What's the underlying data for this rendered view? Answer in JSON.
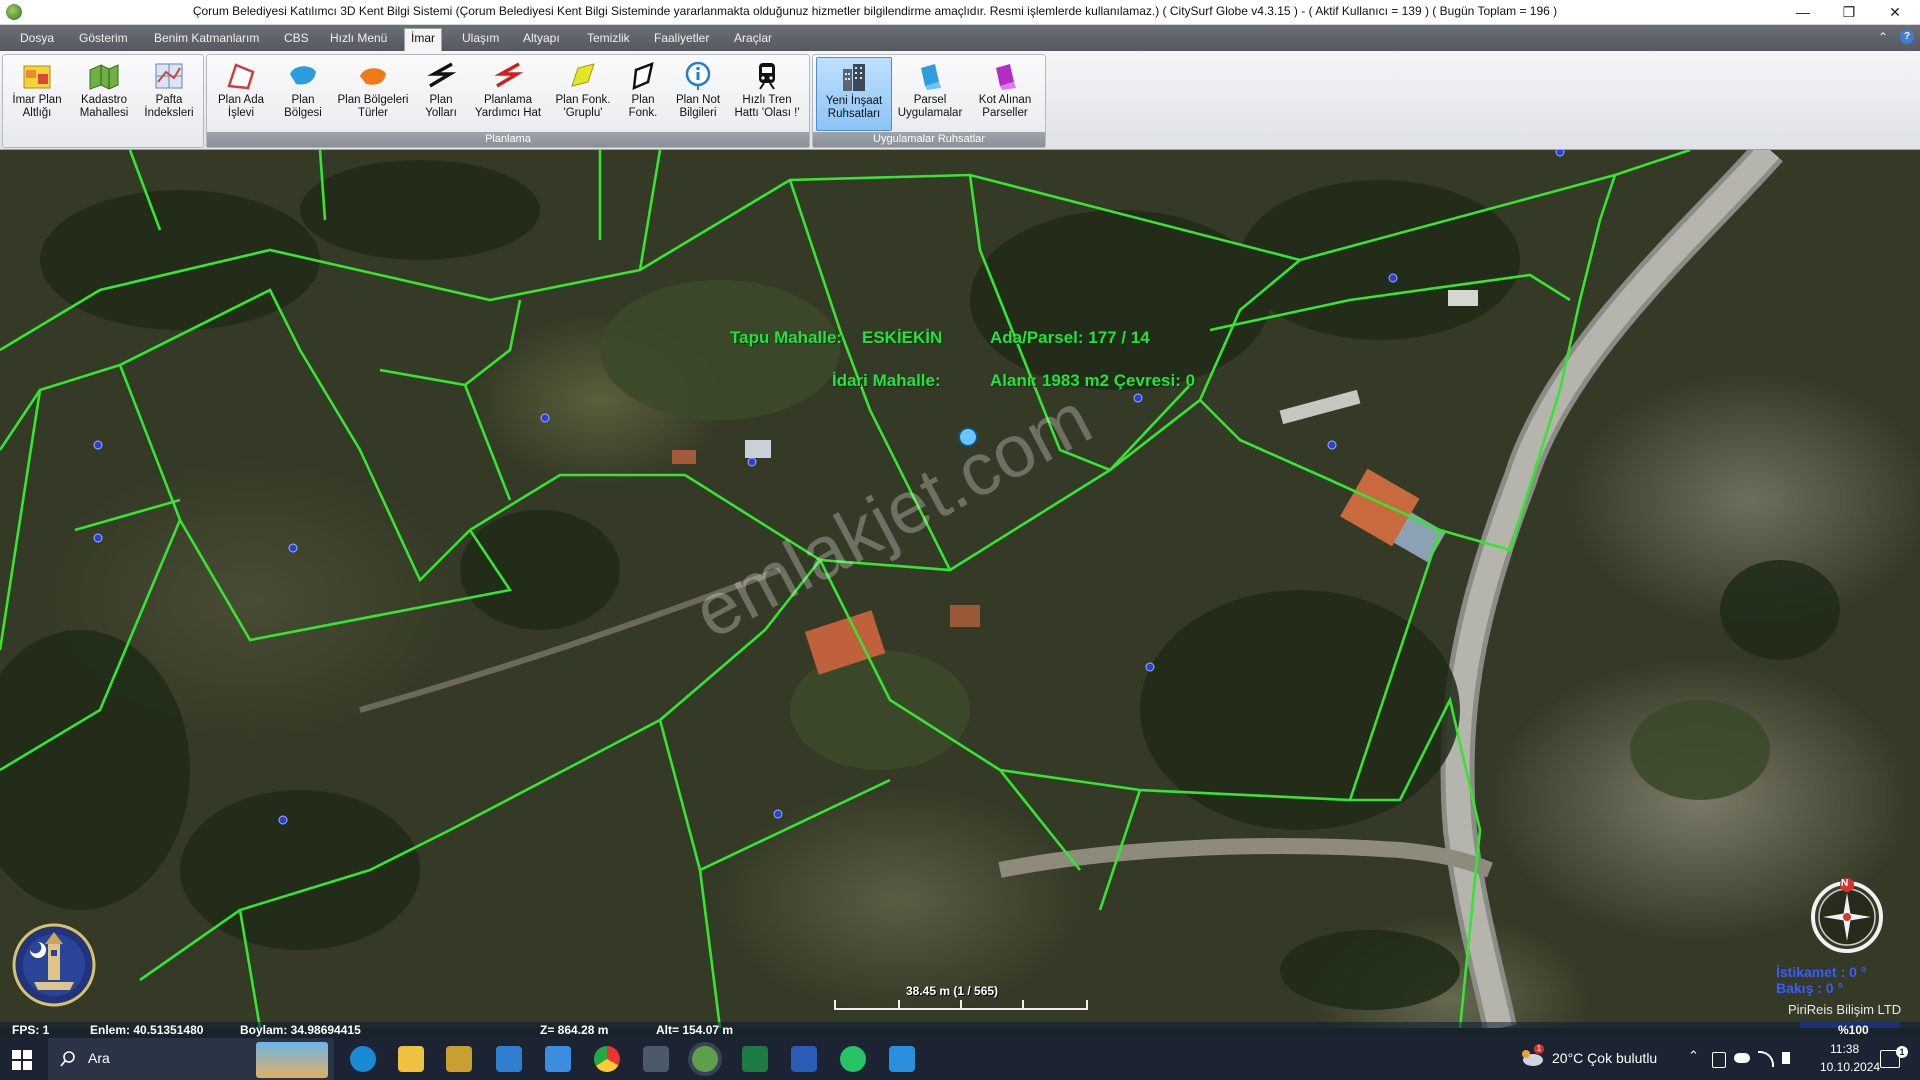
{
  "window": {
    "title": "Çorum Belediyesi Katılımcı 3D Kent Bilgi Sistemi (Çorum Belediyesi Kent Bilgi Sisteminde yararlanmakta olduğunuz hizmetler bilgilendirme amaçlıdır. Resmi işlemlerde kullanılamaz.)   ( CitySurf Globe v4.3.15 ) -   ( Aktif Kullanıcı = 139 )   ( Bugün Toplam = 196 )",
    "minimize": "—",
    "restore": "❐",
    "close": "✕"
  },
  "menu": {
    "items": [
      "Dosya",
      "Gösterim",
      "Benim Katmanlarım",
      "CBS",
      "Hızlı Menü",
      "İmar",
      "Ulaşım",
      "Altyapı",
      "Temizlik",
      "Faaliyetler",
      "Araçlar"
    ],
    "active": "İmar",
    "collapse": "⌃",
    "help": "?"
  },
  "ribbon": {
    "group_imar": {
      "buttons": [
        {
          "line1": "İmar Plan",
          "line2": "Altlığı"
        },
        {
          "line1": "Kadastro",
          "line2": "Mahallesi"
        },
        {
          "line1": "Pafta",
          "line2": "İndeksleri"
        }
      ]
    },
    "group_planlama": {
      "label": "Planlama",
      "buttons": [
        {
          "line1": "Plan Ada",
          "line2": "İşlevi"
        },
        {
          "line1": "Plan",
          "line2": "Bölgesi"
        },
        {
          "line1": "Plan Bölgeleri",
          "line2": "Türler"
        },
        {
          "line1": "Plan",
          "line2": "Yolları"
        },
        {
          "line1": "Planlama",
          "line2": "Yardımcı Hat"
        },
        {
          "line1": "Plan Fonk.",
          "line2": "'Gruplu'"
        },
        {
          "line1": "Plan",
          "line2": "Fonk."
        },
        {
          "line1": "Plan Not",
          "line2": "Bilgileri"
        },
        {
          "line1": "Hızlı Tren",
          "line2": "Hattı 'Olası !'"
        }
      ]
    },
    "group_ruhsat": {
      "label": "Uygulamalar Ruhsatlar",
      "buttons": [
        {
          "line1": "Yeni İnşaat",
          "line2": "Ruhsatları"
        },
        {
          "line1": "Parsel",
          "line2": "Uygulamalar"
        },
        {
          "line1": "Kot Alınan",
          "line2": "Parseller"
        }
      ]
    }
  },
  "map": {
    "parcel_info": {
      "tapu_mahalle_label": "Tapu Mahalle:",
      "tapu_mahalle_value": "ESKİEKİN",
      "ada_parsel": "Ada/Parsel: 177 / 14",
      "idari_mahalle_label": "İdari Mahalle:",
      "alan_cevre": "Alanı: 1983 m2  Çevresi: 0"
    },
    "watermark": "emlakjet.com",
    "compass": {
      "north_letter": "N",
      "istikamet": "İstikamet : 0 °",
      "bakis": "Bakış : 0 °"
    },
    "scale": {
      "text": "38.45 m    (1 / 565)"
    },
    "credit": "PiriReis Bilişim LTD",
    "zoom": "%100",
    "logo_lettering": "ÇORUM BELEDİYESİ 1876"
  },
  "status": {
    "fps": "FPS: 1",
    "enlem": "Enlem: 40.51351480",
    "boylam": "Boylam: 34.98694415",
    "z": "Z= 864.28 m",
    "alt": "Alt= 154.07 m"
  },
  "taskbar": {
    "search_placeholder": "Ara",
    "weather": "20°C  Çok bulutlu",
    "time": "11:38",
    "date": "10.10.2024",
    "notification_count": "1"
  },
  "colors": {
    "parcel_line": "#34e62f",
    "ribbon_selected": "#8cc4f5",
    "taskbar": "#1c2333"
  }
}
